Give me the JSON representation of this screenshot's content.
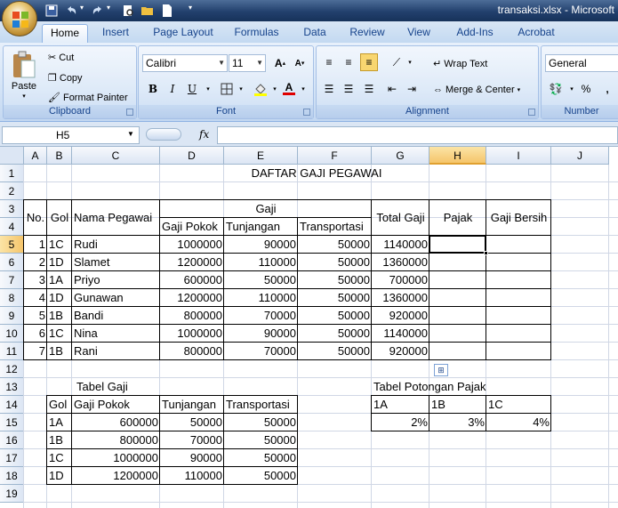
{
  "window": {
    "title": "transaksi.xlsx - Microsoft"
  },
  "tabs": [
    "Home",
    "Insert",
    "Page Layout",
    "Formulas",
    "Data",
    "Review",
    "View",
    "Add-Ins",
    "Acrobat"
  ],
  "active_tab": "Home",
  "clipboard": {
    "paste": "Paste",
    "cut": "Cut",
    "copy": "Copy",
    "format_painter": "Format Painter",
    "label": "Clipboard"
  },
  "font": {
    "name": "Calibri",
    "size": "11",
    "label": "Font"
  },
  "alignment": {
    "wrap": "Wrap Text",
    "merge": "Merge & Center",
    "label": "Alignment"
  },
  "number": {
    "format": "General",
    "percent": "%",
    "comma": ",",
    "label": "Number"
  },
  "formula_bar": {
    "name_box": "H5",
    "fx": "fx",
    "value": ""
  },
  "columns": [
    "A",
    "B",
    "C",
    "D",
    "E",
    "F",
    "G",
    "H",
    "I",
    "J"
  ],
  "rows": [
    "1",
    "2",
    "3",
    "4",
    "5",
    "6",
    "7",
    "8",
    "9",
    "10",
    "11",
    "12",
    "13",
    "14",
    "15",
    "16",
    "17",
    "18",
    "19"
  ],
  "sheet": {
    "title": "DAFTAR GAJI PEGAWAI",
    "headers": {
      "no": "No.",
      "gol": "Gol",
      "nama": "Nama Pegawai",
      "gaji": "Gaji",
      "gaji_pokok": "Gaji Pokok",
      "tunjangan": "Tunjangan",
      "transportasi": "Transportasi",
      "total": "Total Gaji",
      "pajak": "Pajak",
      "bersih": "Gaji Bersih"
    },
    "data": [
      [
        "1",
        "1C",
        "Rudi",
        "1000000",
        "90000",
        "50000",
        "1140000"
      ],
      [
        "2",
        "1D",
        "Slamet",
        "1200000",
        "110000",
        "50000",
        "1360000"
      ],
      [
        "3",
        "1A",
        "Priyo",
        "600000",
        "50000",
        "50000",
        "700000"
      ],
      [
        "4",
        "1D",
        "Gunawan",
        "1200000",
        "110000",
        "50000",
        "1360000"
      ],
      [
        "5",
        "1B",
        "Bandi",
        "800000",
        "70000",
        "50000",
        "920000"
      ],
      [
        "6",
        "1C",
        "Nina",
        "1000000",
        "90000",
        "50000",
        "1140000"
      ],
      [
        "7",
        "1B",
        "Rani",
        "800000",
        "70000",
        "50000",
        "920000"
      ]
    ],
    "tabel_gaji": {
      "title": "Tabel Gaji",
      "headers": [
        "Gol",
        "Gaji Pokok",
        "Tunjangan",
        "Transportasi"
      ],
      "rows": [
        [
          "1A",
          "600000",
          "50000",
          "50000"
        ],
        [
          "1B",
          "800000",
          "70000",
          "50000"
        ],
        [
          "1C",
          "1000000",
          "90000",
          "50000"
        ],
        [
          "1D",
          "1200000",
          "110000",
          "50000"
        ]
      ]
    },
    "tabel_pajak": {
      "title": "Tabel Potongan Pajak",
      "headers": [
        "1A",
        "1B",
        "1C"
      ],
      "values": [
        "2%",
        "3%",
        "4%"
      ]
    }
  },
  "selected_cell": "H5",
  "colors": {
    "accent": "#15428b",
    "selection_header": "#f5c56b",
    "grid": "#d0d7e5"
  }
}
